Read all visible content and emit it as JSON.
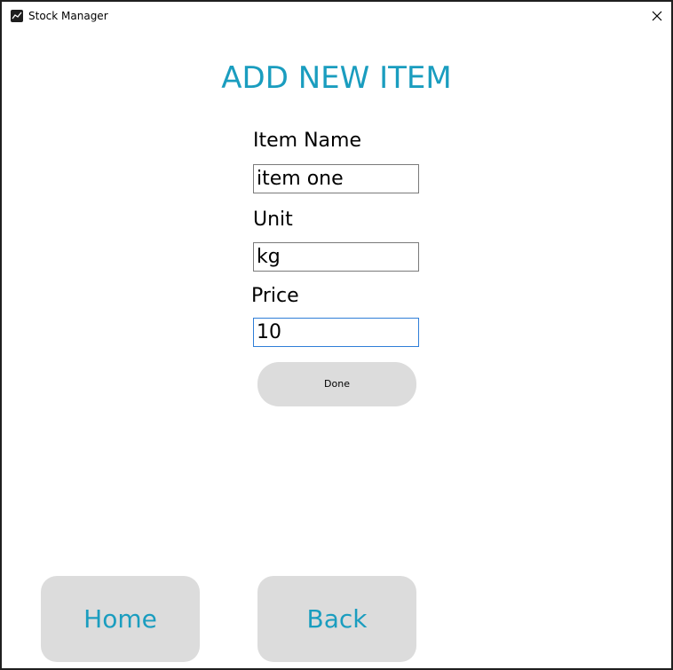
{
  "window": {
    "title": "Stock Manager",
    "app_icon": "chart-icon",
    "close_icon": "close-icon"
  },
  "page": {
    "heading": "ADD NEW ITEM"
  },
  "form": {
    "item_name_label": "Item Name",
    "item_name_value": "item one",
    "unit_label": "Unit",
    "unit_value": "kg",
    "price_label": "Price",
    "price_value": "10",
    "done_label": "Done"
  },
  "nav": {
    "home_label": "Home",
    "back_label": "Back"
  },
  "colors": {
    "accent": "#1a9dbf",
    "button_bg": "#dcdcdc",
    "active_border": "#2f7ed8"
  }
}
